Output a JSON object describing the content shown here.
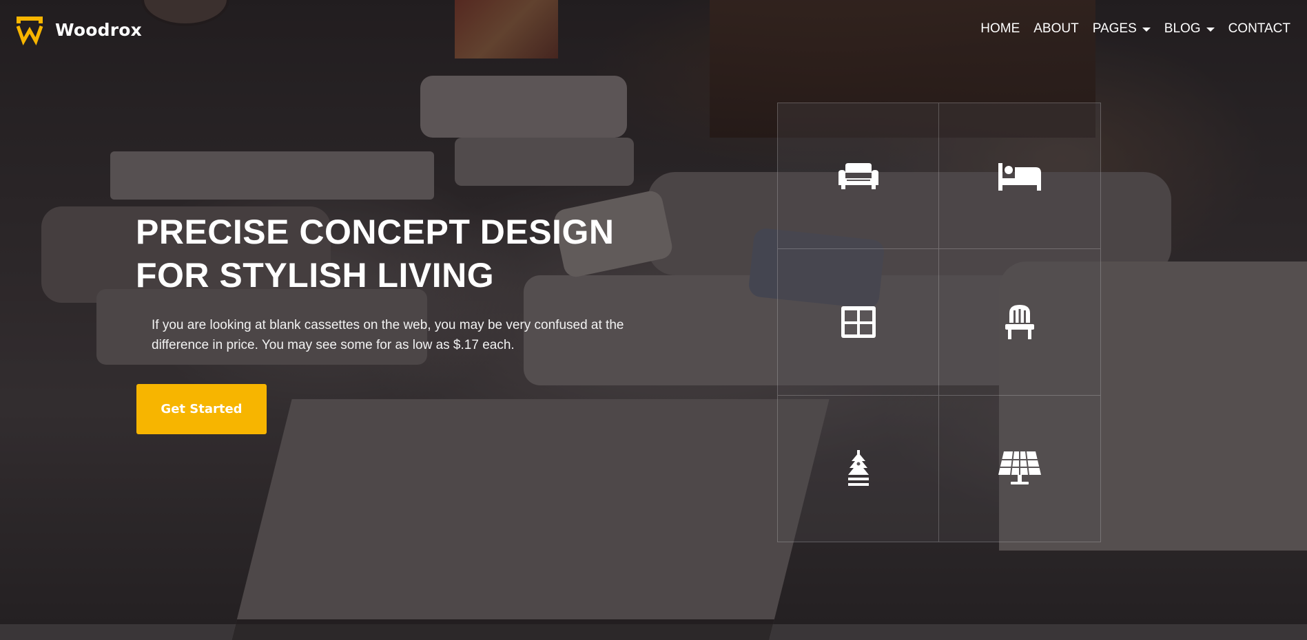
{
  "brand": {
    "name": "Woodrox",
    "accent_color": "#f7b500",
    "logo_icon": "logo-icon"
  },
  "nav": {
    "items": [
      {
        "label": "HOME",
        "dropdown": false
      },
      {
        "label": "ABOUT",
        "dropdown": false
      },
      {
        "label": "PAGES",
        "dropdown": true
      },
      {
        "label": "BLOG",
        "dropdown": true
      },
      {
        "label": "CONTACT",
        "dropdown": false
      }
    ]
  },
  "hero": {
    "title_line1": "PRECISE CONCEPT DESIGN",
    "title_line2": "FOR STYLISH LIVING",
    "description": "If you are looking at blank cassettes on the web, you may be very confused at the difference in price. You may see some for as low as $.17 each.",
    "cta_label": "Get Started",
    "cta_color": "#f7b500"
  },
  "categories": [
    {
      "icon": "sofa-icon"
    },
    {
      "icon": "bed-icon"
    },
    {
      "icon": "cabinet-icon"
    },
    {
      "icon": "chair-icon"
    },
    {
      "icon": "tree-lamp-icon"
    },
    {
      "icon": "solar-panel-icon"
    }
  ]
}
